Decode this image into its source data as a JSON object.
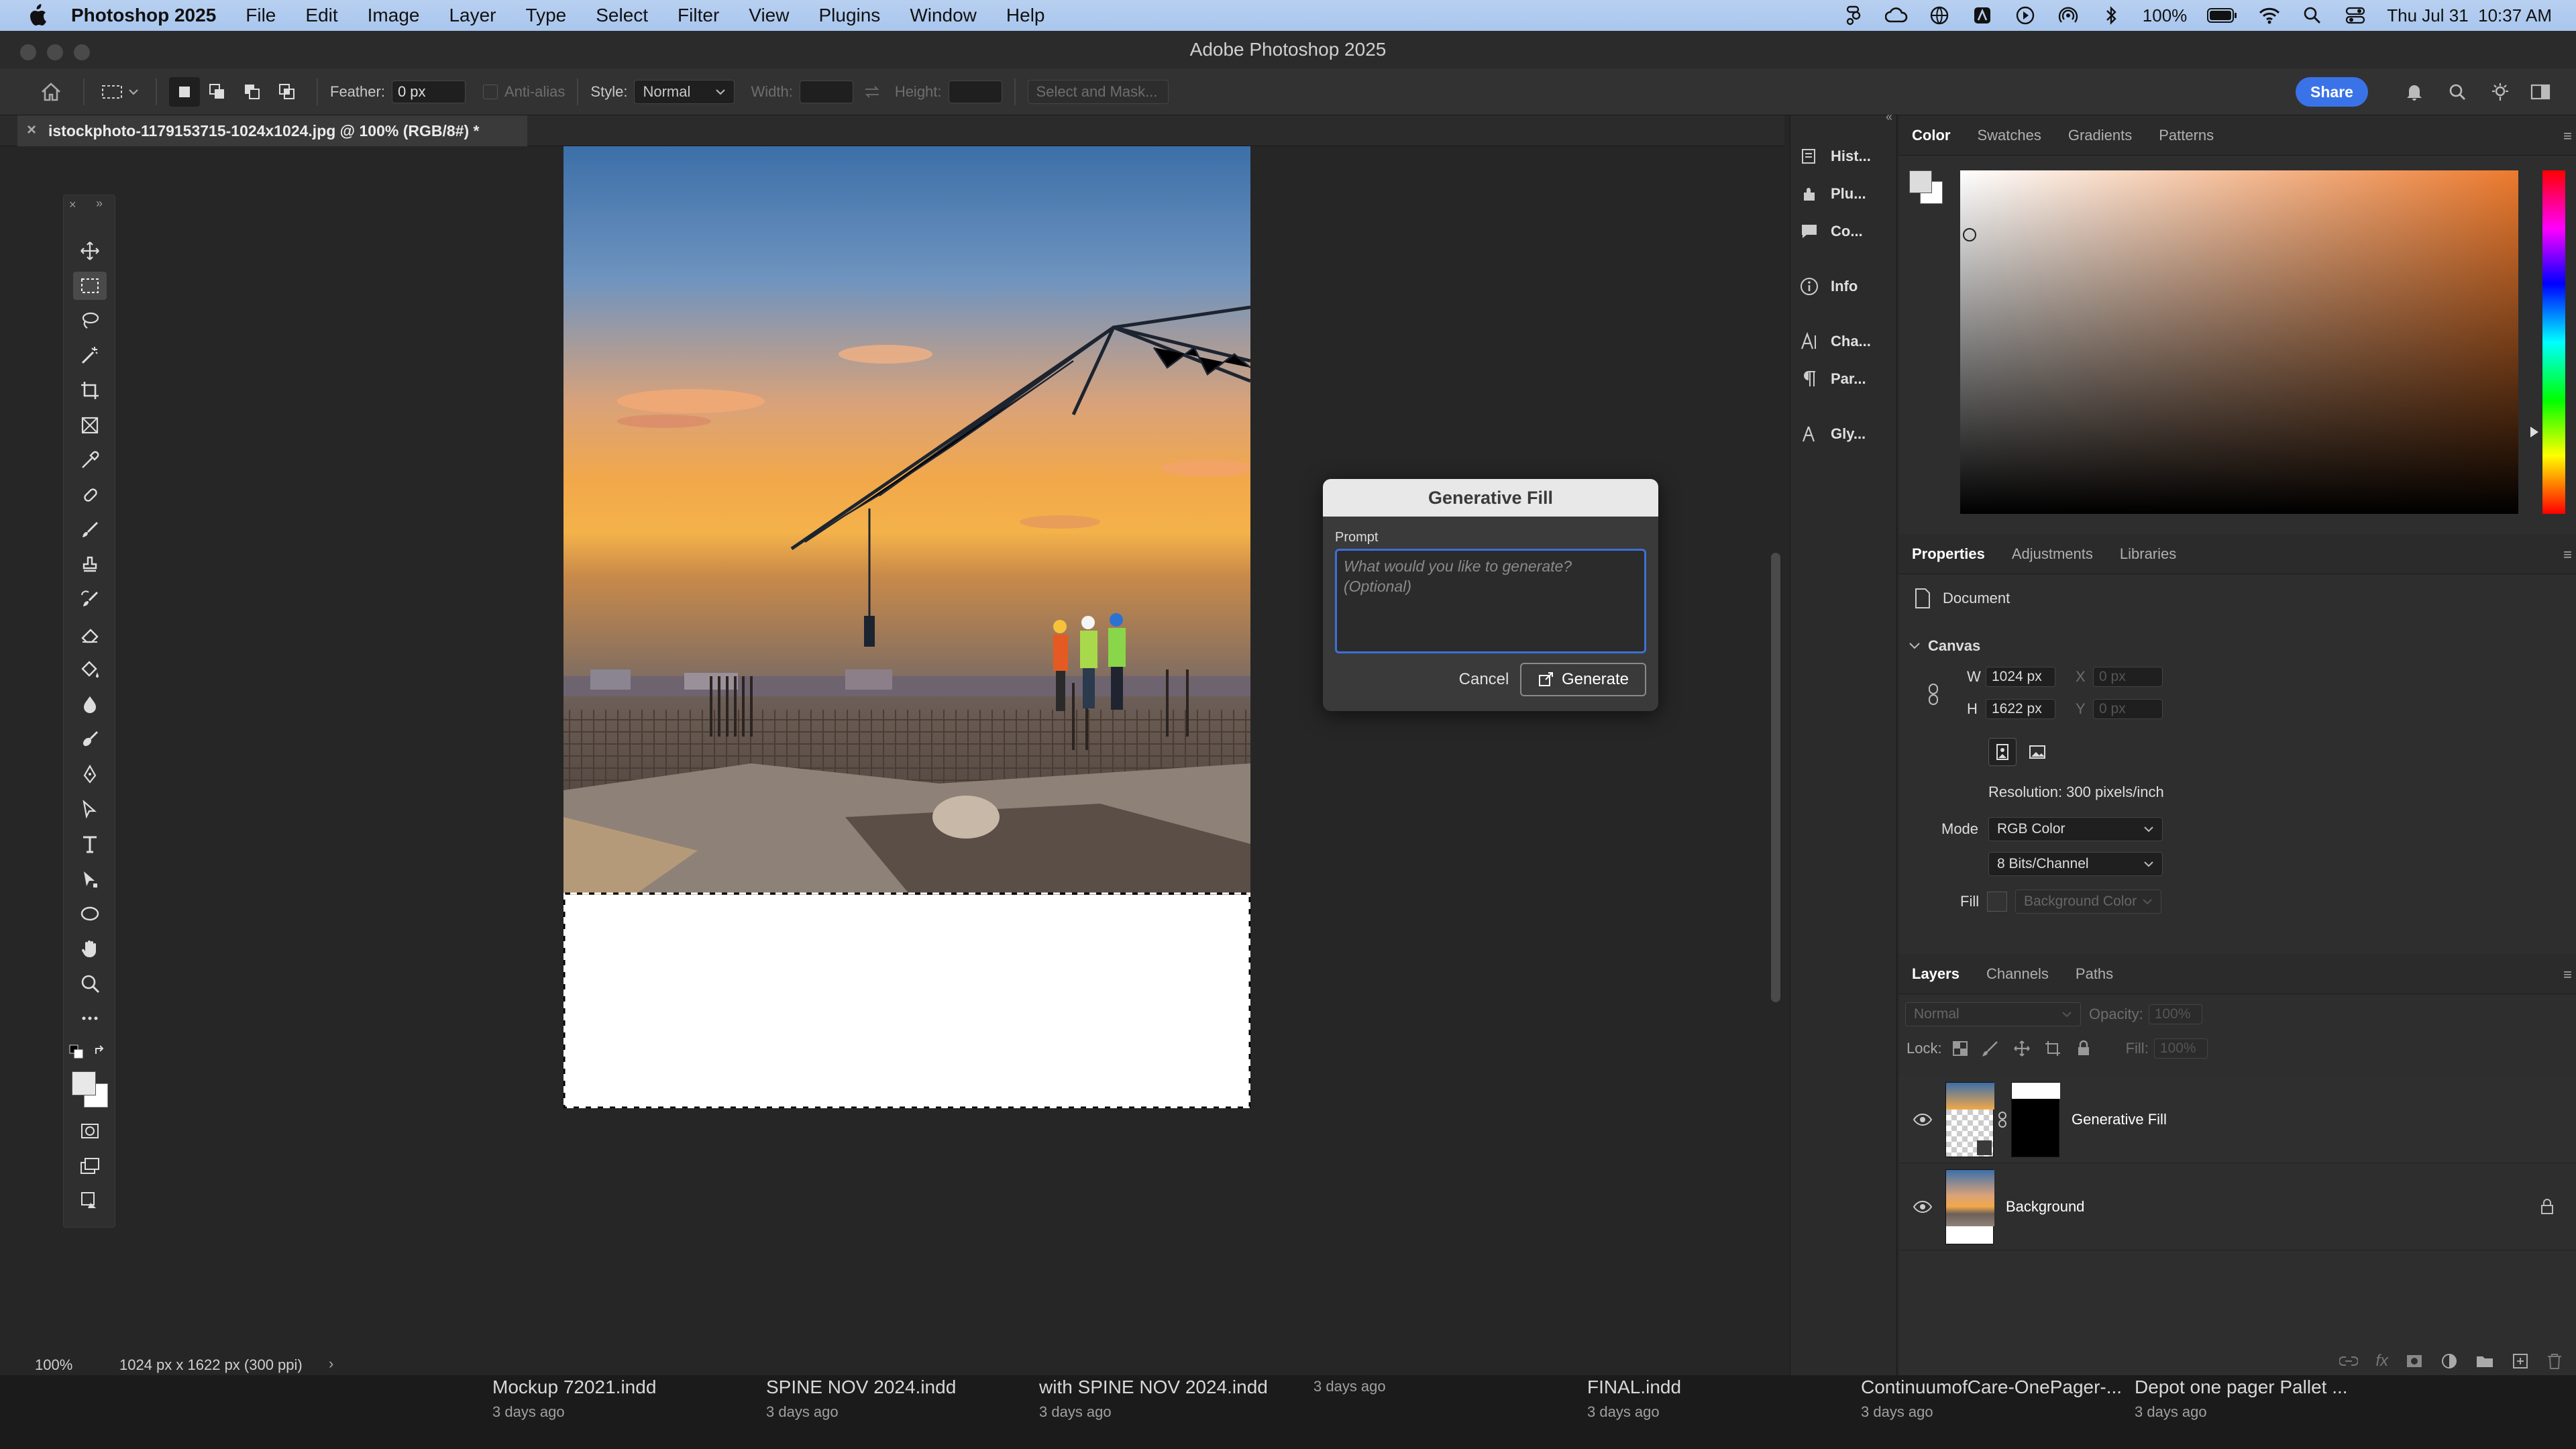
{
  "menubar": {
    "app_name": "Photoshop 2025",
    "menus": [
      "File",
      "Edit",
      "Image",
      "Layer",
      "Type",
      "Select",
      "Filter",
      "View",
      "Plugins",
      "Window",
      "Help"
    ],
    "battery": "100%",
    "clock": "Thu Jul 31  10:37 AM"
  },
  "window": {
    "title": "Adobe Photoshop 2025"
  },
  "options": {
    "feather_label": "Feather:",
    "feather_value": "0 px",
    "antialias_label": "Anti-alias",
    "style_label": "Style:",
    "style_value": "Normal",
    "width_label": "Width:",
    "height_label": "Height:",
    "select_mask": "Select and Mask...",
    "share": "Share"
  },
  "document": {
    "tab_title": "istockphoto-1179153715-1024x1024.jpg @ 100% (RGB/8#) *"
  },
  "dialog": {
    "title": "Generative Fill",
    "prompt_label": "Prompt",
    "prompt_placeholder": "What would you like to generate? (Optional)",
    "cancel": "Cancel",
    "generate": "Generate"
  },
  "status": {
    "zoom": "100%",
    "doc_info": "1024 px x 1622 px (300 ppi)"
  },
  "dock": {
    "items": [
      "Hist...",
      "Plu...",
      "Co...",
      "Info",
      "Cha...",
      "Par...",
      "Gly..."
    ]
  },
  "color_panel": {
    "tabs": [
      "Color",
      "Swatches",
      "Gradients",
      "Patterns"
    ],
    "hue_color": "#ec7a2e"
  },
  "properties": {
    "tabs": [
      "Properties",
      "Adjustments",
      "Libraries"
    ],
    "document_label": "Document",
    "canvas_label": "Canvas",
    "w_label": "W",
    "w_value": "1024 px",
    "h_label": "H",
    "h_value": "1622 px",
    "x_label": "X",
    "x_placeholder": "0 px",
    "y_label": "Y",
    "y_placeholder": "0 px",
    "resolution": "Resolution: 300 pixels/inch",
    "mode_label": "Mode",
    "mode_value": "RGB Color",
    "bits_value": "8 Bits/Channel",
    "fill_label": "Fill",
    "fill_value": "Background Color"
  },
  "layers": {
    "tabs": [
      "Layers",
      "Channels",
      "Paths"
    ],
    "blend_mode": "Normal",
    "opacity_label": "Opacity:",
    "opacity_value": "100%",
    "lock_label": "Lock:",
    "fill_label": "Fill:",
    "fill_value": "100%",
    "items": [
      {
        "name": "Generative Fill"
      },
      {
        "name": "Background"
      }
    ]
  },
  "recent_files": [
    {
      "name": "Mockup 72021.indd",
      "date": "3 days ago"
    },
    {
      "name": "SPINE NOV 2024.indd",
      "date": "3 days ago"
    },
    {
      "name": "with SPINE NOV 2024.indd",
      "date": "3 days ago"
    },
    {
      "name": "",
      "date": "3 days ago"
    },
    {
      "name": "FINAL.indd",
      "date": "3 days ago"
    },
    {
      "name": "ContinuumofCare-OnePager-...",
      "date": "3 days ago"
    },
    {
      "name": "Depot one pager Pallet ...",
      "date": "3 days ago"
    }
  ]
}
